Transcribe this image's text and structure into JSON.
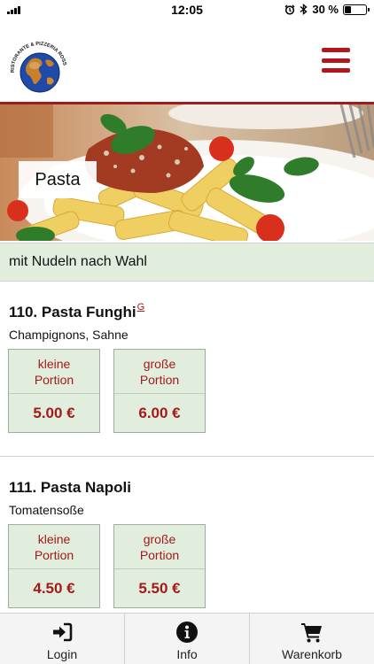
{
  "status_bar": {
    "time": "12:05",
    "battery_text": "30 %",
    "battery_level": 0.3,
    "icons": [
      "signal-icon",
      "alarm-icon",
      "bluetooth-icon",
      "battery-icon"
    ]
  },
  "header": {
    "logo_text": "RISTORANTE & PIZZERIA ROSSO",
    "menu_icon": "hamburger-menu-icon",
    "accent_color": "#b3161b"
  },
  "hero": {
    "category_title": "Pasta"
  },
  "category_bar": {
    "text": "mit Nudeln nach Wahl"
  },
  "items": [
    {
      "number_title": "110. Pasta Funghi",
      "superscript": "G",
      "description": "Champignons, Sahne",
      "options": [
        {
          "label_line1": "kleine",
          "label_line2": "Portion",
          "price": "5.00 €"
        },
        {
          "label_line1": "große",
          "label_line2": "Portion",
          "price": "6.00 €"
        }
      ]
    },
    {
      "number_title": "111. Pasta Napoli",
      "description": "Tomatensoße",
      "options": [
        {
          "label_line1": "kleine",
          "label_line2": "Portion",
          "price": "4.50 €"
        },
        {
          "label_line1": "große",
          "label_line2": "Portion",
          "price": "5.50 €"
        }
      ]
    }
  ],
  "tab_bar": {
    "tabs": [
      {
        "label": "Login",
        "icon": "login-icon"
      },
      {
        "label": "Info",
        "icon": "info-icon"
      },
      {
        "label": "Warenkorb",
        "icon": "cart-icon"
      }
    ]
  },
  "colors": {
    "price_red": "#a31a1a",
    "price_box_bg": "#e1eedd",
    "category_bar_bg": "#e1eedd"
  }
}
